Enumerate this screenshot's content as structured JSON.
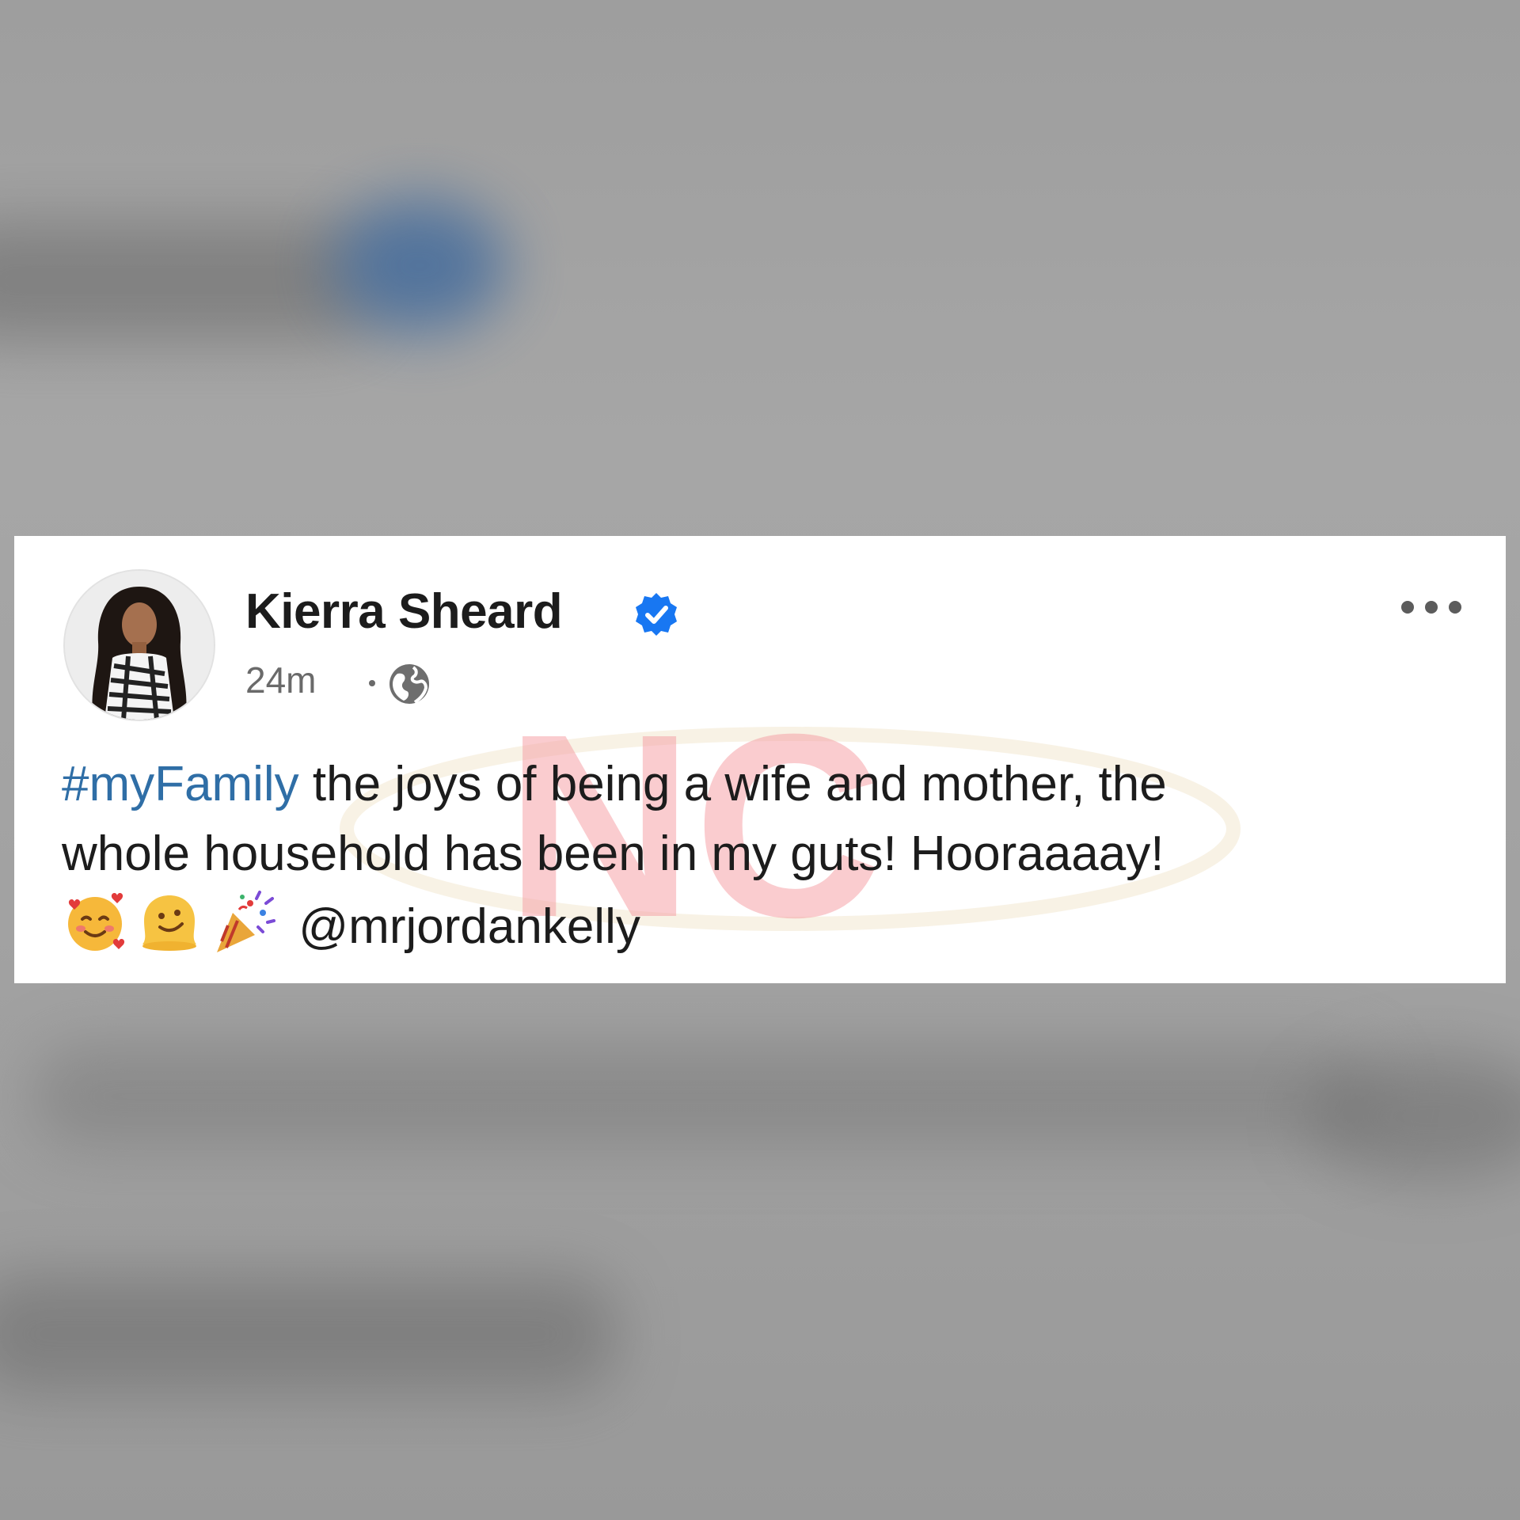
{
  "post": {
    "author_name": "Kierra Sheard",
    "verified": true,
    "time_ago": "24m",
    "audience_icon": "globe-icon",
    "more_icon": "more-options-icon",
    "hashtag": "#myFamily",
    "text_line1": " the joys of being a wife and mother, the",
    "text_line2": "whole household has been in my guts! Hooraaaay!",
    "emojis": [
      "smiling-face-with-hearts-icon",
      "melting-face-icon",
      "party-popper-icon"
    ],
    "mention": "@mrjordankelly"
  },
  "watermark": {
    "text": "NC"
  },
  "colors": {
    "hashtag": "#2f6ea6",
    "verified_badge": "#1877f2",
    "watermark": "#f6a3a8"
  }
}
